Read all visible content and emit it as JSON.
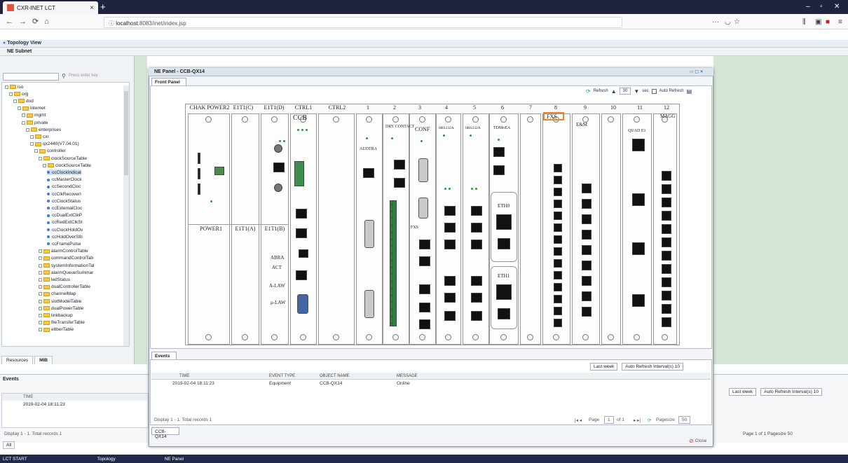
{
  "browser": {
    "tab_title": "CXR-INET LCT",
    "url_host": "localhost",
    "url_rest": ":8083/inet/index.jsp",
    "new_tab": "+"
  },
  "app": {
    "topology_header": "Topology View",
    "subnet_tab": "NE Subnet",
    "search_hint": "Press enter key"
  },
  "tree": [
    {
      "label": "iso",
      "depth": 0,
      "kind": "folder"
    },
    {
      "label": "org",
      "depth": 1,
      "kind": "folder"
    },
    {
      "label": "dod",
      "depth": 2,
      "kind": "folder"
    },
    {
      "label": "internet",
      "depth": 3,
      "kind": "folder"
    },
    {
      "label": "mgmt",
      "depth": 4,
      "kind": "folder"
    },
    {
      "label": "private",
      "depth": 4,
      "kind": "folder"
    },
    {
      "label": "enterprises",
      "depth": 5,
      "kind": "folder"
    },
    {
      "label": "cxr",
      "depth": 6,
      "kind": "folder"
    },
    {
      "label": "qx2440(V7.04.01)",
      "depth": 6,
      "kind": "folder"
    },
    {
      "label": "controller",
      "depth": 7,
      "kind": "folder"
    },
    {
      "label": "clockSourceTable",
      "depth": 8,
      "kind": "folder"
    },
    {
      "label": "clockSourceTable",
      "depth": 9,
      "kind": "folder"
    },
    {
      "label": "ccClockIndicat",
      "depth": 10,
      "kind": "leaf"
    },
    {
      "label": "ccMasterClock",
      "depth": 10,
      "kind": "leaf"
    },
    {
      "label": "ccSecondCloc",
      "depth": 10,
      "kind": "leaf"
    },
    {
      "label": "ccClkRecoverI",
      "depth": 10,
      "kind": "leaf"
    },
    {
      "label": "ccClockStatus",
      "depth": 10,
      "kind": "leaf"
    },
    {
      "label": "ccExternalCloc",
      "depth": 10,
      "kind": "leaf"
    },
    {
      "label": "ccDualExtClkP",
      "depth": 10,
      "kind": "leaf"
    },
    {
      "label": "ccRedExtClkSt",
      "depth": 10,
      "kind": "leaf"
    },
    {
      "label": "ccClockHoldOv",
      "depth": 10,
      "kind": "leaf"
    },
    {
      "label": "ccHoldOverStb",
      "depth": 10,
      "kind": "leaf"
    },
    {
      "label": "ccFramePulse",
      "depth": 10,
      "kind": "leaf"
    },
    {
      "label": "alarmControlTable",
      "depth": 8,
      "kind": "folder"
    },
    {
      "label": "commandControlTab",
      "depth": 8,
      "kind": "folder"
    },
    {
      "label": "systemInformationTal",
      "depth": 8,
      "kind": "folder"
    },
    {
      "label": "alarmQueueSummar",
      "depth": 8,
      "kind": "folder"
    },
    {
      "label": "ledStatus",
      "depth": 8,
      "kind": "folder"
    },
    {
      "label": "dualControllerTable",
      "depth": 8,
      "kind": "folder"
    },
    {
      "label": "channelMap",
      "depth": 8,
      "kind": "folder"
    },
    {
      "label": "slotModelTable",
      "depth": 8,
      "kind": "folder"
    },
    {
      "label": "dualPowerTable",
      "depth": 8,
      "kind": "folder"
    },
    {
      "label": "linkbackup",
      "depth": 8,
      "kind": "folder"
    },
    {
      "label": "fileTransferTable",
      "depth": 8,
      "kind": "folder"
    },
    {
      "label": "e8berTable",
      "depth": 8,
      "kind": "folder"
    }
  ],
  "left_tabs": [
    "Resources",
    "MIB"
  ],
  "ne_panel": {
    "title": "NE Panel - CCB-QX14",
    "front_tab": "Front Panel",
    "refresh": "Refresh",
    "interval": "30",
    "sec": "sec",
    "auto_refresh": "Auto Refresh",
    "slot_labels_top": [
      "CHAK POWER2",
      "E1T1(C)",
      "E1T1(D)",
      "CTRL1",
      "CTRL2",
      "1",
      "2",
      "3",
      "4",
      "5",
      "6",
      "7",
      "8",
      "9",
      "10",
      "11",
      "12"
    ],
    "slot_labels_bottom": [
      "POWER1",
      "E1T1(A)",
      "E1T1(B)"
    ],
    "card_texts": {
      "ccb": "CCB",
      "rs232": "RS232",
      "abra": "ABRA",
      "act": "ACT",
      "alaw": "A-LAW",
      "ulaw": "μ-LAW",
      "audtra": "AUDTRA",
      "dry_contact": "DRY CONTACT",
      "conf": "CONF",
      "fxs": "FXS",
      "e_and_m": "E&M",
      "quad_e1": "QUAD E1",
      "magg": "MAGG",
      "tdm_eth": "TDMoEA",
      "eth0": "ETH0",
      "eth1": "ETH1",
      "six_rs232_a": "6RS232A",
      "six_rs232_b": "6RS232A"
    }
  },
  "events": {
    "tab": "Events",
    "filter_period": "Last week",
    "auto_interval": "Auto Refresh Interval(s) 10",
    "columns": [
      "TIME",
      "EVENT TYPE",
      "OBJECT NAME",
      "MESSAGE"
    ],
    "rows": [
      {
        "time": "2019-02-04 18:11:23",
        "type": "Equipment",
        "object": "CCB-QX14",
        "message": "Online"
      }
    ],
    "status": "Display 1 - 1. Total records 1",
    "page_label": "Page",
    "page_value": "1",
    "of": "of 1",
    "pagesize_label": "Pagesize",
    "pagesize_value": "50"
  },
  "ne_bottom_tab": "CCB-QX14",
  "close_label": "Close",
  "outer_events": {
    "title": "Events",
    "col": "TIME",
    "row_time": "2019-02-04 18:11:23",
    "status": "Display 1 - 1. Total records 1",
    "all_tab": "All",
    "period": "Last week",
    "interval": "Auto Refresh Interval(s) 10",
    "pager": "Page  1 of 1   Pagesize 50"
  },
  "taskbar": [
    "LCT START",
    "Topology",
    "NE Panel"
  ]
}
